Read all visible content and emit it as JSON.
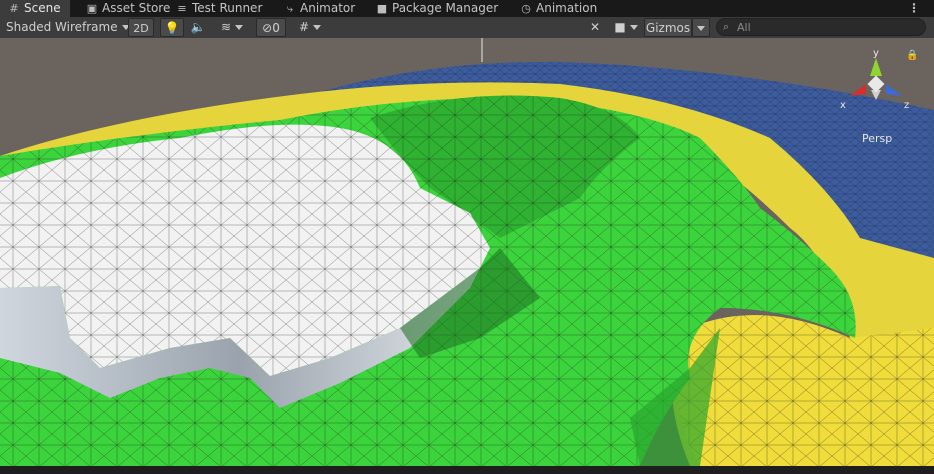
{
  "tabs": [
    {
      "label": "Scene",
      "icon": "hash-icon",
      "active": true
    },
    {
      "label": "Asset Store",
      "icon": "bag-icon"
    },
    {
      "label": "Test Runner",
      "icon": "list-icon"
    },
    {
      "label": "Animator",
      "icon": "animator-icon"
    },
    {
      "label": "Package Manager",
      "icon": "package-icon"
    },
    {
      "label": "Animation",
      "icon": "clock-icon"
    }
  ],
  "toolbar": {
    "shading_mode": "Shaded Wireframe",
    "mode_2d": "2D",
    "hidden_count": "0",
    "gizmos": "Gizmos",
    "search_placeholder": "All"
  },
  "orientation_gizmo": {
    "axis_y": "y",
    "axis_x": "x",
    "axis_z": "z",
    "projection": "Persp"
  },
  "colors": {
    "editor_bg": "#191919",
    "toolbar_bg": "#3c3c3c",
    "water": "#3b5b9a",
    "sand": "#e8d640",
    "grass": "#3dd63d",
    "snow": "#f0f0f0"
  }
}
